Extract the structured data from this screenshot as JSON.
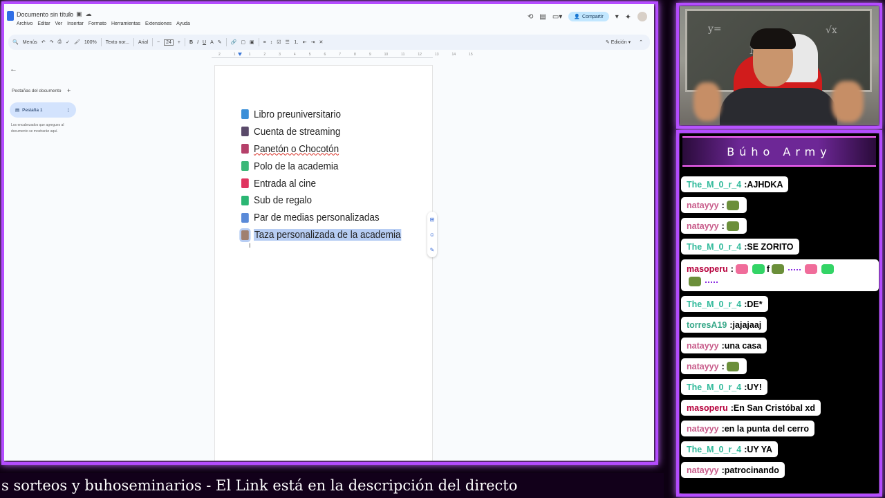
{
  "docs": {
    "title": "Documento sin título",
    "menu": [
      "Archivo",
      "Editar",
      "Ver",
      "Insertar",
      "Formato",
      "Herramientas",
      "Extensiones",
      "Ayuda"
    ],
    "share_label": "Compartir",
    "toolbar": {
      "menus_label": "Menús",
      "zoom": "100%",
      "style": "Texto nor...",
      "font": "Arial",
      "font_size": "24",
      "mode": "Edición"
    },
    "ruler_marks": [
      "2",
      "1",
      "1",
      "2",
      "3",
      "4",
      "5",
      "6",
      "7",
      "8",
      "9",
      "10",
      "11",
      "12",
      "13",
      "14",
      "15"
    ],
    "sidebar": {
      "tabs_heading": "Pestañas del documento",
      "tab_name": "Pestaña 1",
      "note": "Los encabezados que agregues al documento se mostrarán aquí."
    },
    "list": [
      {
        "text": "Libro preuniversitario",
        "emoji_color": "#3a8fd8"
      },
      {
        "text": "Cuenta de streaming",
        "emoji_color": "#5a4a6a"
      },
      {
        "text": "Panetón o Chocotón",
        "emoji_color": "#b5406a"
      },
      {
        "text": "Polo de la academia",
        "emoji_color": "#3cb878"
      },
      {
        "text": "Entrada al cine",
        "emoji_color": "#e03560"
      },
      {
        "text": "Sub de regalo",
        "emoji_color": "#2bb673"
      },
      {
        "text": "Par de medias personalizadas",
        "emoji_color": "#5a8ad8"
      },
      {
        "text": "Taza personalizada de la academia",
        "emoji_color": "#a08070"
      }
    ]
  },
  "cam": {
    "chalk": [
      "N",
      "√x",
      "y="
    ]
  },
  "chat": {
    "title": "Búho Army",
    "messages": [
      {
        "user": "The_M_0_r_4",
        "text": "AJHDKA",
        "user_color": "the"
      },
      {
        "user": "natayyy",
        "text": "",
        "emotes": [
          "frog"
        ],
        "user_color": "nat"
      },
      {
        "user": "natayyy",
        "text": "",
        "emotes": [
          "frog"
        ],
        "user_color": "nat"
      },
      {
        "user": "The_M_0_r_4",
        "text": "SE ZORITO",
        "user_color": "the"
      },
      {
        "user": "masoperu",
        "text": "f",
        "user_color": "mas"
      },
      {
        "user": "The_M_0_r_4",
        "text": "DE*",
        "user_color": "the"
      },
      {
        "user": "torresA19",
        "text": "jajajaaj",
        "user_color": "tor"
      },
      {
        "user": "natayyy",
        "text": "una casa",
        "user_color": "nat"
      },
      {
        "user": "natayyy",
        "text": "",
        "emotes": [
          "frog"
        ],
        "user_color": "nat"
      },
      {
        "user": "The_M_0_r_4",
        "text": "UY!",
        "user_color": "the"
      },
      {
        "user": "masoperu",
        "text": "En San Cristóbal xd",
        "user_color": "mas"
      },
      {
        "user": "natayyy",
        "text": "en la punta del cerro",
        "user_color": "nat"
      },
      {
        "user": "The_M_0_r_4",
        "text": "UY YA",
        "user_color": "the"
      },
      {
        "user": "natayyy",
        "text": "patrocinando",
        "user_color": "nat"
      }
    ]
  },
  "ticker": {
    "text": "s sorteos y buhoseminarios   -   El Link está en la descripción del directo"
  },
  "colors": {
    "frame": "#b44cff",
    "selection": "#b7cdf3",
    "share": "#c2e7ff"
  }
}
